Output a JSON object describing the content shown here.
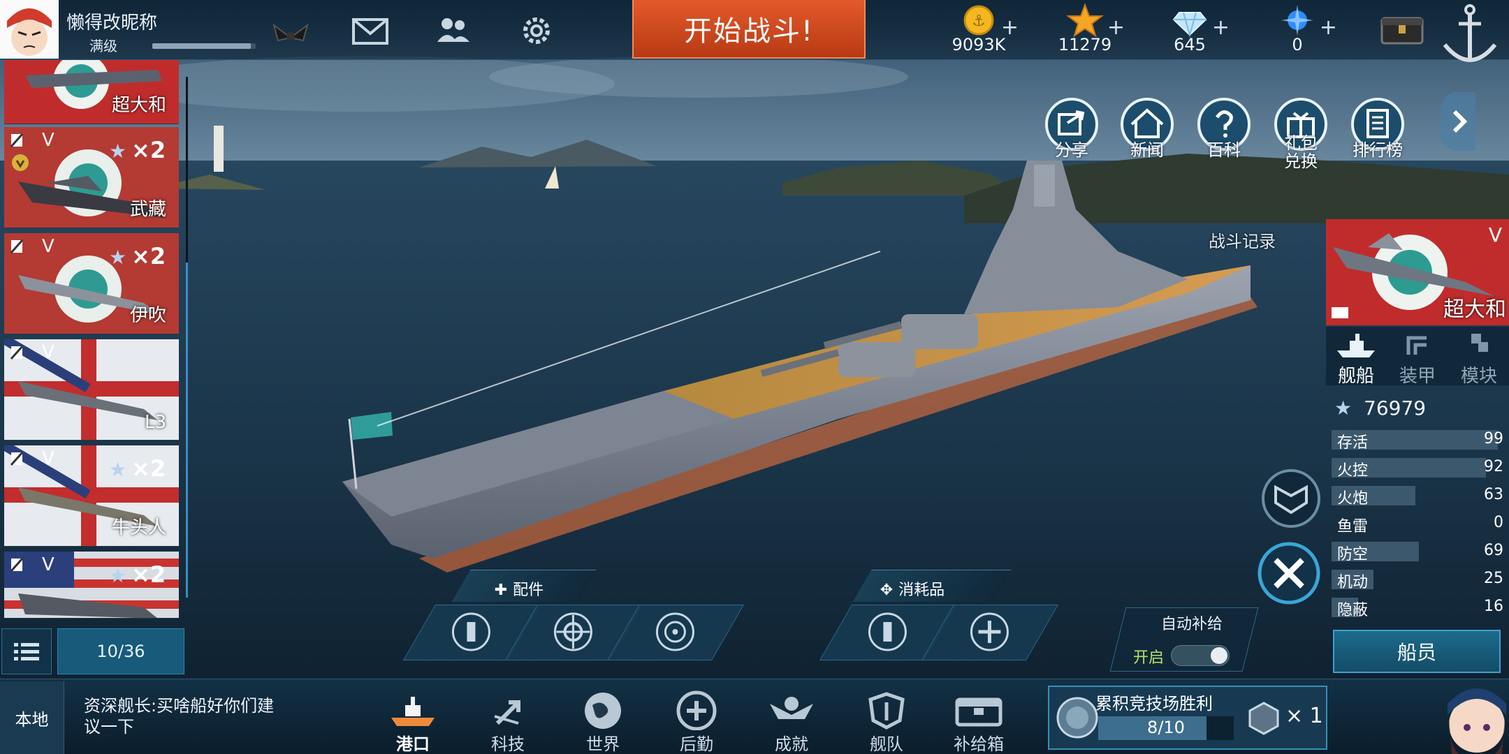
{
  "player": {
    "nickname": "懒得改昵称",
    "level_label": "满级",
    "exp_fraction": 0.95
  },
  "topbar": {
    "start_battle": "开始战斗!",
    "icons": [
      "wings-badge-icon",
      "mail-icon",
      "friends-icon",
      "gear-icon"
    ],
    "currencies": [
      {
        "name": "gold-coin-icon",
        "value": "9093K",
        "color": "#f3b820"
      },
      {
        "name": "star-icon",
        "value": "11279",
        "color": "#f5a623"
      },
      {
        "name": "diamond-icon",
        "value": "645",
        "color": "#bfe6ff"
      },
      {
        "name": "blue-crystal-icon",
        "value": "0",
        "color": "#2f8cff"
      }
    ],
    "chest_icon": "treasure-chest-icon",
    "anchor_icon": "anchor-icon"
  },
  "ship_list": {
    "selected": {
      "name": "超大和"
    },
    "cards": [
      {
        "tier": "V",
        "mult": "×2",
        "name": "武藏",
        "flag": "japan"
      },
      {
        "tier": "V",
        "mult": "×2",
        "name": "伊吹",
        "flag": "japan"
      },
      {
        "tier": "V",
        "mult": "",
        "name": "L3",
        "flag": "uk"
      },
      {
        "tier": "V",
        "mult": "×2",
        "name": "牛头人",
        "flag": "uk"
      },
      {
        "tier": "V",
        "mult": "×2",
        "name": "",
        "flag": "usa"
      }
    ],
    "count": "10/36"
  },
  "top_menu": [
    {
      "id": "share",
      "label": "分享"
    },
    {
      "id": "news",
      "label": "新闻"
    },
    {
      "id": "wiki",
      "label": "百科"
    },
    {
      "id": "gift",
      "label": "礼包\n兑换"
    },
    {
      "id": "rank",
      "label": "排行榜"
    }
  ],
  "right_panel": {
    "battle_record": "战斗记录",
    "ship_tier": "V",
    "ship_name": "超大和",
    "tabs": [
      "舰船",
      "装甲",
      "模块"
    ],
    "active_tab": 0,
    "power": "76979",
    "stats": [
      {
        "label": "存活",
        "value": "99",
        "fraction": 0.99
      },
      {
        "label": "火控",
        "value": "92",
        "fraction": 0.92
      },
      {
        "label": "火炮",
        "value": "63",
        "fraction": 0.5
      },
      {
        "label": "鱼雷",
        "value": "0",
        "fraction": 0
      },
      {
        "label": "防空",
        "value": "69",
        "fraction": 0.52
      },
      {
        "label": "机动",
        "value": "25",
        "fraction": 0.25
      },
      {
        "label": "隐蔽",
        "value": "16",
        "fraction": 0.16
      }
    ],
    "crew": "船员"
  },
  "equipment": {
    "parts_label": "配件",
    "consumables_label": "消耗品"
  },
  "auto_supply": {
    "title": "自动补给",
    "state": "开启"
  },
  "bottom": {
    "chat_channel": "本地",
    "chat_message": "资深舰长:买啥船好你们建议一下",
    "nav": [
      {
        "label": "港口",
        "icon": "harbor-icon",
        "active": true
      },
      {
        "label": "科技",
        "icon": "tech-icon"
      },
      {
        "label": "世界",
        "icon": "globe-icon"
      },
      {
        "label": "后勤",
        "icon": "logistics-icon"
      },
      {
        "label": "成就",
        "icon": "achievement-icon"
      },
      {
        "label": "舰队",
        "icon": "fleet-icon"
      },
      {
        "label": "补给箱",
        "icon": "supply-box-icon"
      }
    ],
    "arena": {
      "title": "累积竞技场胜利",
      "progress": "8/10",
      "fraction": 0.8,
      "multiplier": "× 1"
    }
  }
}
